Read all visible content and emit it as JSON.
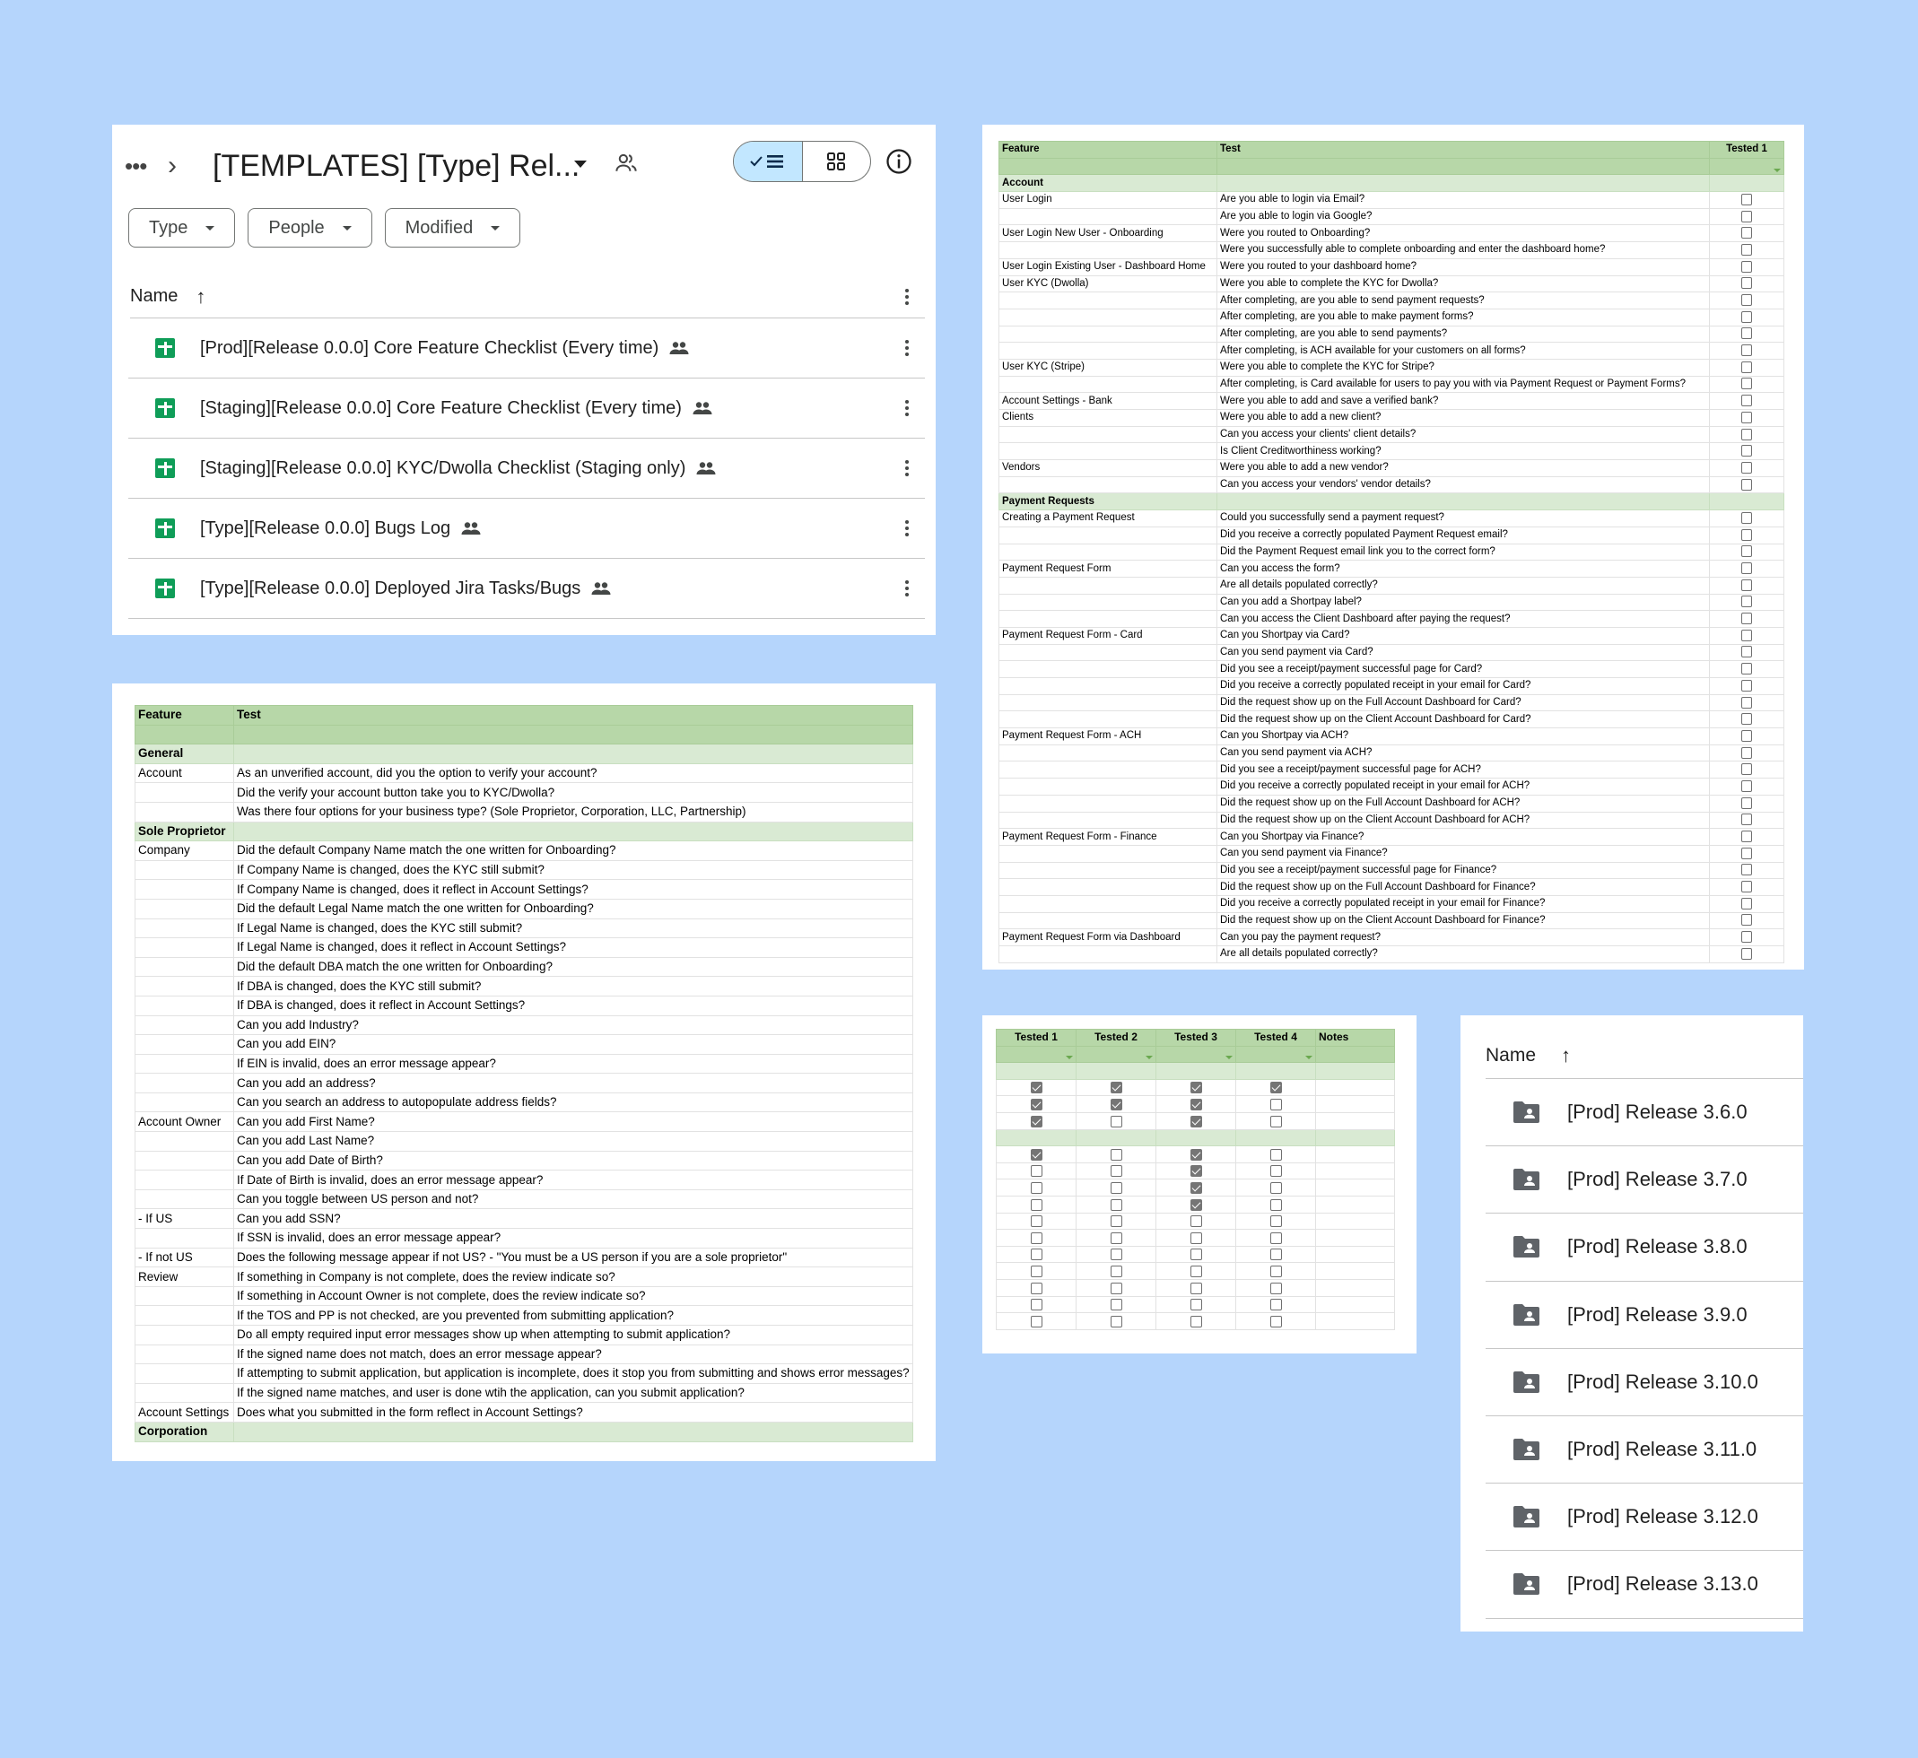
{
  "drive": {
    "breadcrumb_more": "•••",
    "title": "[TEMPLATES] [Type] Rel...",
    "filters": [
      "Type",
      "People",
      "Modified"
    ],
    "column_name": "Name",
    "files": [
      {
        "name": "[Prod][Release 0.0.0] Core Feature Checklist (Every time)",
        "type": "spreadsheet",
        "shared": true
      },
      {
        "name": "[Staging][Release 0.0.0] Core Feature Checklist (Every time)",
        "type": "spreadsheet",
        "shared": true
      },
      {
        "name": "[Staging][Release 0.0.0] KYC/Dwolla Checklist (Staging only)",
        "type": "spreadsheet",
        "shared": true
      },
      {
        "name": "[Type][Release 0.0.0] Bugs Log",
        "type": "spreadsheet",
        "shared": true
      },
      {
        "name": "[Type][Release 0.0.0] Deployed Jira Tasks/Bugs",
        "type": "spreadsheet",
        "shared": true
      }
    ],
    "view_mode": "list"
  },
  "kyc_sheet": {
    "headers": [
      "Feature",
      "Test"
    ],
    "rows": [
      {
        "section": "General"
      },
      {
        "feature": "Account",
        "test": "As an unverified account, did you the option to verify your account?"
      },
      {
        "feature": "",
        "test": "Did the verify your account button take you to KYC/Dwolla?"
      },
      {
        "feature": "",
        "test": "Was there four options for your business type? (Sole Proprietor, Corporation, LLC, Partnership)"
      },
      {
        "section": "Sole Proprietor"
      },
      {
        "feature": "Company",
        "test": "Did the default Company Name match the one written for Onboarding?"
      },
      {
        "feature": "",
        "test": "If Company Name is changed, does the KYC still submit?"
      },
      {
        "feature": "",
        "test": "If Company Name is changed, does it reflect in Account Settings?"
      },
      {
        "feature": "",
        "test": "Did the default Legal Name match the one written for Onboarding?"
      },
      {
        "feature": "",
        "test": "If Legal Name is changed, does the KYC still submit?"
      },
      {
        "feature": "",
        "test": "If Legal Name is changed, does it reflect in Account Settings?"
      },
      {
        "feature": "",
        "test": "Did the default DBA match the one written for Onboarding?"
      },
      {
        "feature": "",
        "test": "If DBA is changed, does the KYC still submit?"
      },
      {
        "feature": "",
        "test": "If DBA is changed, does it reflect in Account Settings?"
      },
      {
        "feature": "",
        "test": "Can you add Industry?"
      },
      {
        "feature": "",
        "test": "Can you add EIN?"
      },
      {
        "feature": "",
        "test": "If EIN is invalid, does an error message appear?"
      },
      {
        "feature": "",
        "test": "Can you add an address?"
      },
      {
        "feature": "",
        "test": "Can you search an address to autopopulate address fields?"
      },
      {
        "feature": "Account Owner",
        "test": "Can you add First Name?"
      },
      {
        "feature": "",
        "test": "Can you add Last Name?"
      },
      {
        "feature": "",
        "test": "Can you add Date of Birth?"
      },
      {
        "feature": "",
        "test": "If Date of Birth is invalid, does an error message appear?"
      },
      {
        "feature": "",
        "test": "Can you toggle between US person and not?"
      },
      {
        "feature": "- If US",
        "test": "Can you add SSN?"
      },
      {
        "feature": "",
        "test": "If SSN is invalid, does an error message appear?"
      },
      {
        "feature": "- If not US",
        "test": "Does the following message appear if not US? - \"You must be a US person if you are a sole proprietor\""
      },
      {
        "feature": "Review",
        "test": "If something in Company is not complete, does the review indicate so?"
      },
      {
        "feature": "",
        "test": "If something in Account Owner is not complete, does the review indicate so?"
      },
      {
        "feature": "",
        "test": "If the TOS and PP is not checked, are you prevented from submitting application?"
      },
      {
        "feature": "",
        "test": "Do all empty required input error messages show up when attempting to submit application?"
      },
      {
        "feature": "",
        "test": "If the signed name does not match, does an error message appear?"
      },
      {
        "feature": "",
        "test": "If attempting to submit application, but application is incomplete, does it stop you from submitting and shows error messages?"
      },
      {
        "feature": "",
        "test": "If the signed name matches, and user is done wtih the application, can you submit application?"
      },
      {
        "feature": "Account Settings",
        "test": "Does what you submitted in the form reflect in Account Settings?"
      },
      {
        "section": "Corporation"
      }
    ]
  },
  "core_sheet": {
    "headers": [
      "Feature",
      "Test",
      "Tested 1"
    ],
    "rows": [
      {
        "section": "Account"
      },
      {
        "feature": "User Login",
        "test": "Are you able to login via Email?",
        "tested": false
      },
      {
        "feature": "",
        "test": "Are you able to login via Google?",
        "tested": false
      },
      {
        "feature": "User Login New User - Onboarding",
        "test": "Were you routed to Onboarding?",
        "tested": false
      },
      {
        "feature": "",
        "test": "Were you successfully able to complete onboarding and enter the dashboard home?",
        "tested": false
      },
      {
        "feature": "User Login Existing User - Dashboard Home",
        "test": "Were you routed to your dashboard home?",
        "tested": false
      },
      {
        "feature": "User KYC (Dwolla)",
        "test": "Were you able to complete the KYC for Dwolla?",
        "tested": false
      },
      {
        "feature": "",
        "test": "After completing, are you able to send payment requests?",
        "tested": false
      },
      {
        "feature": "",
        "test": "After completing, are you able to make payment forms?",
        "tested": false
      },
      {
        "feature": "",
        "test": "After completing, are you able to send payments?",
        "tested": false
      },
      {
        "feature": "",
        "test": "After completing, is ACH available for your customers on all forms?",
        "tested": false
      },
      {
        "feature": "User KYC (Stripe)",
        "test": "Were you able to complete the KYC for Stripe?",
        "tested": false
      },
      {
        "feature": "",
        "test": "After completing, is Card available for users to pay you with via Payment Request or Payment Forms?",
        "tested": false
      },
      {
        "feature": "Account Settings - Bank",
        "test": "Were you able to add and save a verified bank?",
        "tested": false
      },
      {
        "feature": "Clients",
        "test": "Were you able to add a new client?",
        "tested": false
      },
      {
        "feature": "",
        "test": "Can you access your clients' client details?",
        "tested": false
      },
      {
        "feature": "",
        "test": "Is Client Creditworthiness working?",
        "tested": false
      },
      {
        "feature": "Vendors",
        "test": "Were you able to add a new vendor?",
        "tested": false
      },
      {
        "feature": "",
        "test": "Can you access your vendors' vendor details?",
        "tested": false
      },
      {
        "section": "Payment Requests"
      },
      {
        "feature": "Creating a Payment Request",
        "test": "Could you successfully send a payment request?",
        "tested": false
      },
      {
        "feature": "",
        "test": "Did you receive a correctly populated Payment Request email?",
        "tested": false
      },
      {
        "feature": "",
        "test": "Did the Payment Request email link you to the correct form?",
        "tested": false
      },
      {
        "feature": "Payment Request Form",
        "test": "Can you access the form?",
        "tested": false
      },
      {
        "feature": "",
        "test": "Are all details populated correctly?",
        "tested": false
      },
      {
        "feature": "",
        "test": "Can you add a Shortpay label?",
        "tested": false
      },
      {
        "feature": "",
        "test": "Can you access the Client Dashboard after paying the request?",
        "tested": false
      },
      {
        "feature": "Payment Request Form - Card",
        "test": "Can you Shortpay via Card?",
        "tested": false
      },
      {
        "feature": "",
        "test": "Can you send payment via Card?",
        "tested": false
      },
      {
        "feature": "",
        "test": "Did you see a receipt/payment successful page for Card?",
        "tested": false
      },
      {
        "feature": "",
        "test": "Did you receive a correctly populated receipt in your email for Card?",
        "tested": false
      },
      {
        "feature": "",
        "test": "Did the request show up on the Full Account Dashboard for Card?",
        "tested": false
      },
      {
        "feature": "",
        "test": "Did the request show up on the Client Account Dashboard for Card?",
        "tested": false
      },
      {
        "feature": "Payment Request Form - ACH",
        "test": "Can you Shortpay via ACH?",
        "tested": false
      },
      {
        "feature": "",
        "test": "Can you send payment via ACH?",
        "tested": false
      },
      {
        "feature": "",
        "test": "Did you see a receipt/payment successful page for ACH?",
        "tested": false
      },
      {
        "feature": "",
        "test": "Did you receive a correctly populated receipt in your email for ACH?",
        "tested": false
      },
      {
        "feature": "",
        "test": "Did the request show up on the Full Account Dashboard for ACH?",
        "tested": false
      },
      {
        "feature": "",
        "test": "Did the request show up on the Client Account Dashboard for ACH?",
        "tested": false
      },
      {
        "feature": "Payment Request Form - Finance",
        "test": "Can you Shortpay via Finance?",
        "tested": false
      },
      {
        "feature": "",
        "test": "Can you send payment via Finance?",
        "tested": false
      },
      {
        "feature": "",
        "test": "Did you see a receipt/payment successful page for Finance?",
        "tested": false
      },
      {
        "feature": "",
        "test": "Did the request show up on the Full Account Dashboard for Finance?",
        "tested": false
      },
      {
        "feature": "",
        "test": "Did you receive a correctly populated receipt in your email for Finance?",
        "tested": false
      },
      {
        "feature": "",
        "test": "Did the request show up on the Client Account Dashboard for Finance?",
        "tested": false
      },
      {
        "feature": "Payment Request Form via Dashboard",
        "test": "Can you pay the payment request?",
        "tested": false
      },
      {
        "feature": "",
        "test": "Are all details populated correctly?",
        "tested": false
      }
    ]
  },
  "tested_grid": {
    "headers": [
      "Tested 1",
      "Tested 2",
      "Tested 3",
      "Tested 4",
      "Notes"
    ],
    "rows": [
      {
        "section": true
      },
      {
        "checks": [
          true,
          true,
          true,
          true
        ]
      },
      {
        "checks": [
          true,
          true,
          true,
          false
        ]
      },
      {
        "checks": [
          true,
          false,
          true,
          false
        ]
      },
      {
        "section": true
      },
      {
        "checks": [
          true,
          false,
          true,
          false
        ]
      },
      {
        "checks": [
          false,
          false,
          true,
          false
        ]
      },
      {
        "checks": [
          false,
          false,
          true,
          false
        ]
      },
      {
        "checks": [
          false,
          false,
          true,
          false
        ]
      },
      {
        "checks": [
          false,
          false,
          false,
          false
        ]
      },
      {
        "checks": [
          false,
          false,
          false,
          false
        ]
      },
      {
        "checks": [
          false,
          false,
          false,
          false
        ]
      },
      {
        "checks": [
          false,
          false,
          false,
          false
        ]
      },
      {
        "checks": [
          false,
          false,
          false,
          false
        ]
      },
      {
        "checks": [
          false,
          false,
          false,
          false
        ]
      },
      {
        "checks": [
          false,
          false,
          false,
          false
        ]
      }
    ]
  },
  "folders": {
    "column_name": "Name",
    "items": [
      "[Prod] Release 3.6.0",
      "[Prod] Release 3.7.0",
      "[Prod] Release 3.8.0",
      "[Prod] Release 3.9.0",
      "[Prod] Release 3.10.0",
      "[Prod] Release 3.11.0",
      "[Prod] Release 3.12.0",
      "[Prod] Release 3.13.0"
    ]
  },
  "colors": {
    "background": "#b5d5fc",
    "header_green": "#b7d7a8",
    "section_green": "#d9ead3",
    "sheets_icon": "#0f9d58",
    "toggle_active": "#c2e7ff",
    "folder_icon": "#5f6368"
  }
}
